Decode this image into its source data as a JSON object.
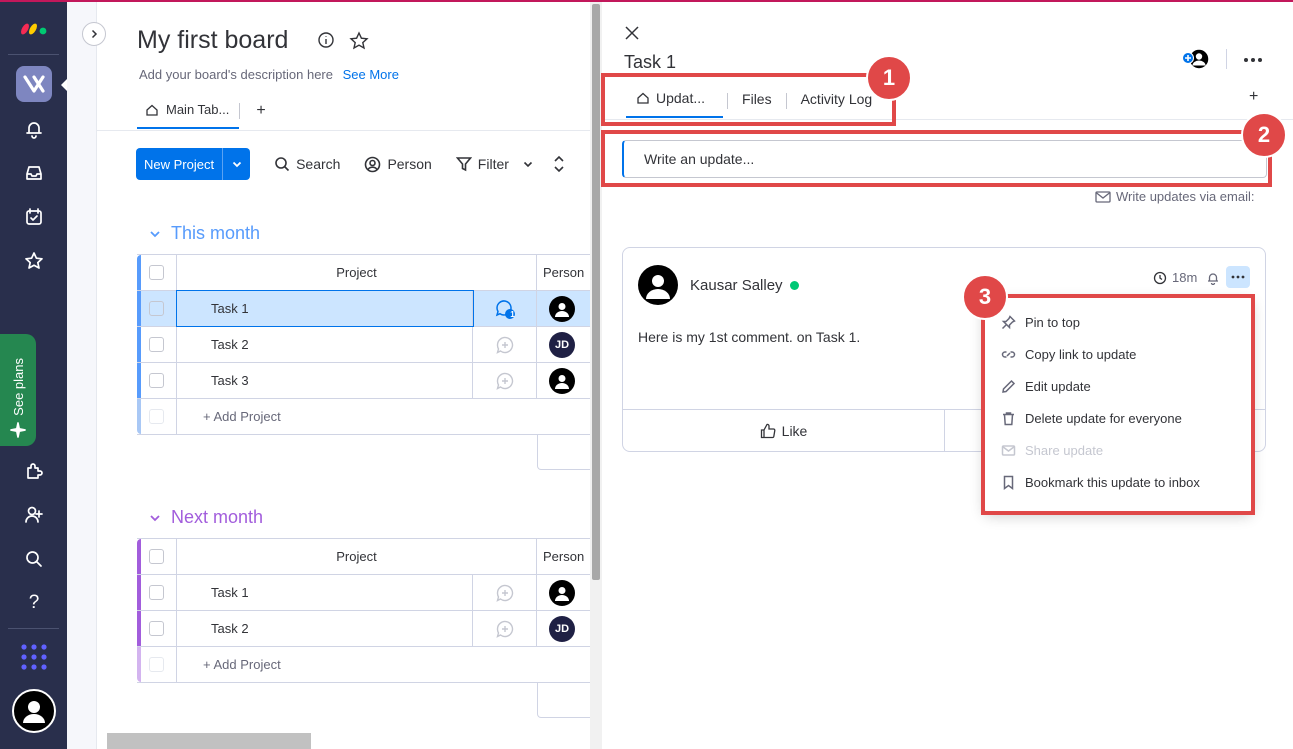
{
  "board": {
    "title": "My first board",
    "description": "Add your board's description here",
    "see_more": "See More",
    "main_tab": "Main Tab...",
    "add_tab": "+",
    "toolbar": {
      "new_project": "New Project",
      "search": "Search",
      "person": "Person",
      "filter": "Filter"
    },
    "groups": [
      {
        "title": "This month",
        "color": "#579bfc",
        "col_project": "Project",
        "col_person": "Person",
        "rows": [
          {
            "name": "Task 1",
            "updates_badge": "1",
            "person": "avatar",
            "selected": true
          },
          {
            "name": "Task 2",
            "person": "JD"
          },
          {
            "name": "Task 3",
            "person": "avatar"
          }
        ],
        "add_label": "+ Add Project"
      },
      {
        "title": "Next month",
        "color": "#a25ddc",
        "col_project": "Project",
        "col_person": "Person",
        "rows": [
          {
            "name": "Task 1",
            "person": "avatar"
          },
          {
            "name": "Task 2",
            "person": "JD"
          }
        ],
        "add_label": "+ Add Project"
      }
    ]
  },
  "sidebar": {
    "see_plans": "See plans",
    "help": "?"
  },
  "panel": {
    "title": "Task 1",
    "tabs": [
      {
        "label": "Updat...",
        "active": true
      },
      {
        "label": "Files"
      },
      {
        "label": "Activity Log"
      }
    ],
    "add_tab": "+",
    "input_placeholder": "Write an update...",
    "email_hint": "Write updates via email:",
    "update": {
      "author": "Kausar Salley",
      "time": "18m",
      "body": "Here is my 1st comment. on Task 1.",
      "like": "Like"
    },
    "menu": [
      {
        "label": "Pin to top",
        "icon": "pin-icon"
      },
      {
        "label": "Copy link to update",
        "icon": "link-icon"
      },
      {
        "label": "Edit update",
        "icon": "pencil-icon"
      },
      {
        "label": "Delete update for everyone",
        "icon": "trash-icon"
      },
      {
        "label": "Share update",
        "icon": "mail-icon",
        "disabled": true
      },
      {
        "label": "Bookmark this update to inbox",
        "icon": "bookmark-icon"
      }
    ]
  },
  "annotations": [
    "1",
    "2",
    "3"
  ],
  "colors": {
    "accent": "#0073ea",
    "annotation": "#e04848",
    "rail": "#292f4c",
    "online": "#00c875"
  }
}
